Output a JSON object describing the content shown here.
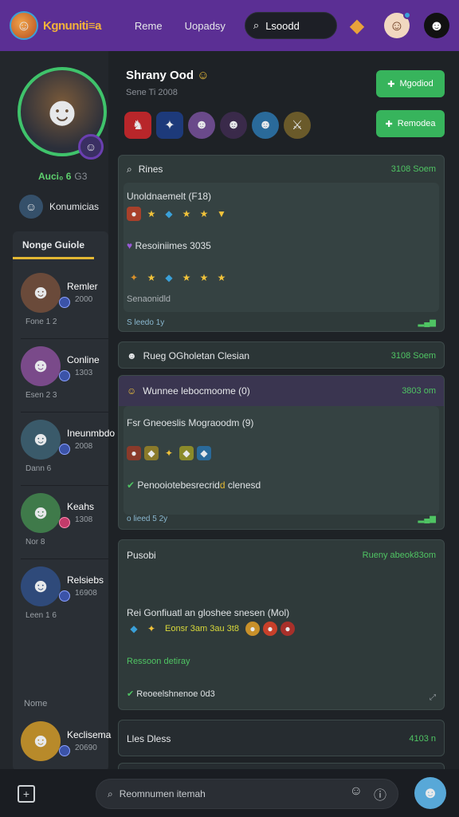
{
  "header": {
    "logo_text": "Kgnuniti≡a",
    "nav": [
      "Reme",
      "Uopadsy"
    ],
    "search_text": "Lsoodd"
  },
  "sidebar": {
    "level_label": "Auci₀ 6",
    "level_sub": "G3",
    "friend_head_name": "Konumicias",
    "panel_title": "Nonge Guiole",
    "players": [
      {
        "name": "Remler",
        "num": "2000",
        "foot": "Fone 1 2"
      },
      {
        "name": "Conline",
        "num": "1303",
        "foot": "Esen 2 3"
      },
      {
        "name": "Ineunmbdo",
        "num": "2008",
        "foot": "Dann 6"
      },
      {
        "name": "Keahs",
        "num": "1308",
        "foot": "Nor 8"
      },
      {
        "name": "Relsiebs",
        "num": "16908",
        "foot": "Leen 1 6"
      }
    ],
    "footer_label": "Nome",
    "footer_player": {
      "name": "Keclisema",
      "num": "20690"
    }
  },
  "main": {
    "title": "Shrany Ood",
    "subtitle": "Sene Ti 2008",
    "btn1": "Mgodiod",
    "btn2": "Remodea",
    "card1": {
      "head": "Rines",
      "time": "3108 Soem",
      "row1": "Unoldnaemelt (F18)",
      "row2": "Resoiniimes 3035",
      "row3": "Senaonidld",
      "foot": "S leedo 1y"
    },
    "card2": {
      "head": "Rueg OGholetan Clesian",
      "time": "3108 Soem"
    },
    "card3": {
      "head": "Wunnee lebocmoome (0)",
      "time": "3803 om",
      "row1": "Fsr Gneoeslis Mograoodm (9)",
      "row2_pre": "Penooiotebesrecrid",
      "row2_hl": "d",
      "row2_post": " clenesd",
      "foot": "o lieed 5 2y"
    },
    "card4": {
      "head": "Pusobi",
      "time": "Rueny abeok83om",
      "row1": "Rei Gonfiuatl an gloshee snesen (Mol)",
      "row1_hl": "Eonsr 3am 3au 3t8",
      "row2": "Ressoon detiray",
      "row3": "Reoeelshnenoe 0d3"
    },
    "card5": {
      "head": "Lles Dless",
      "time": "4103 n"
    }
  },
  "bottom": {
    "placeholder": "Reomnumen itemah"
  },
  "colors": {
    "topbar": "#5b2f94",
    "accent_green": "#37b45c",
    "bg": "#1e2226"
  }
}
